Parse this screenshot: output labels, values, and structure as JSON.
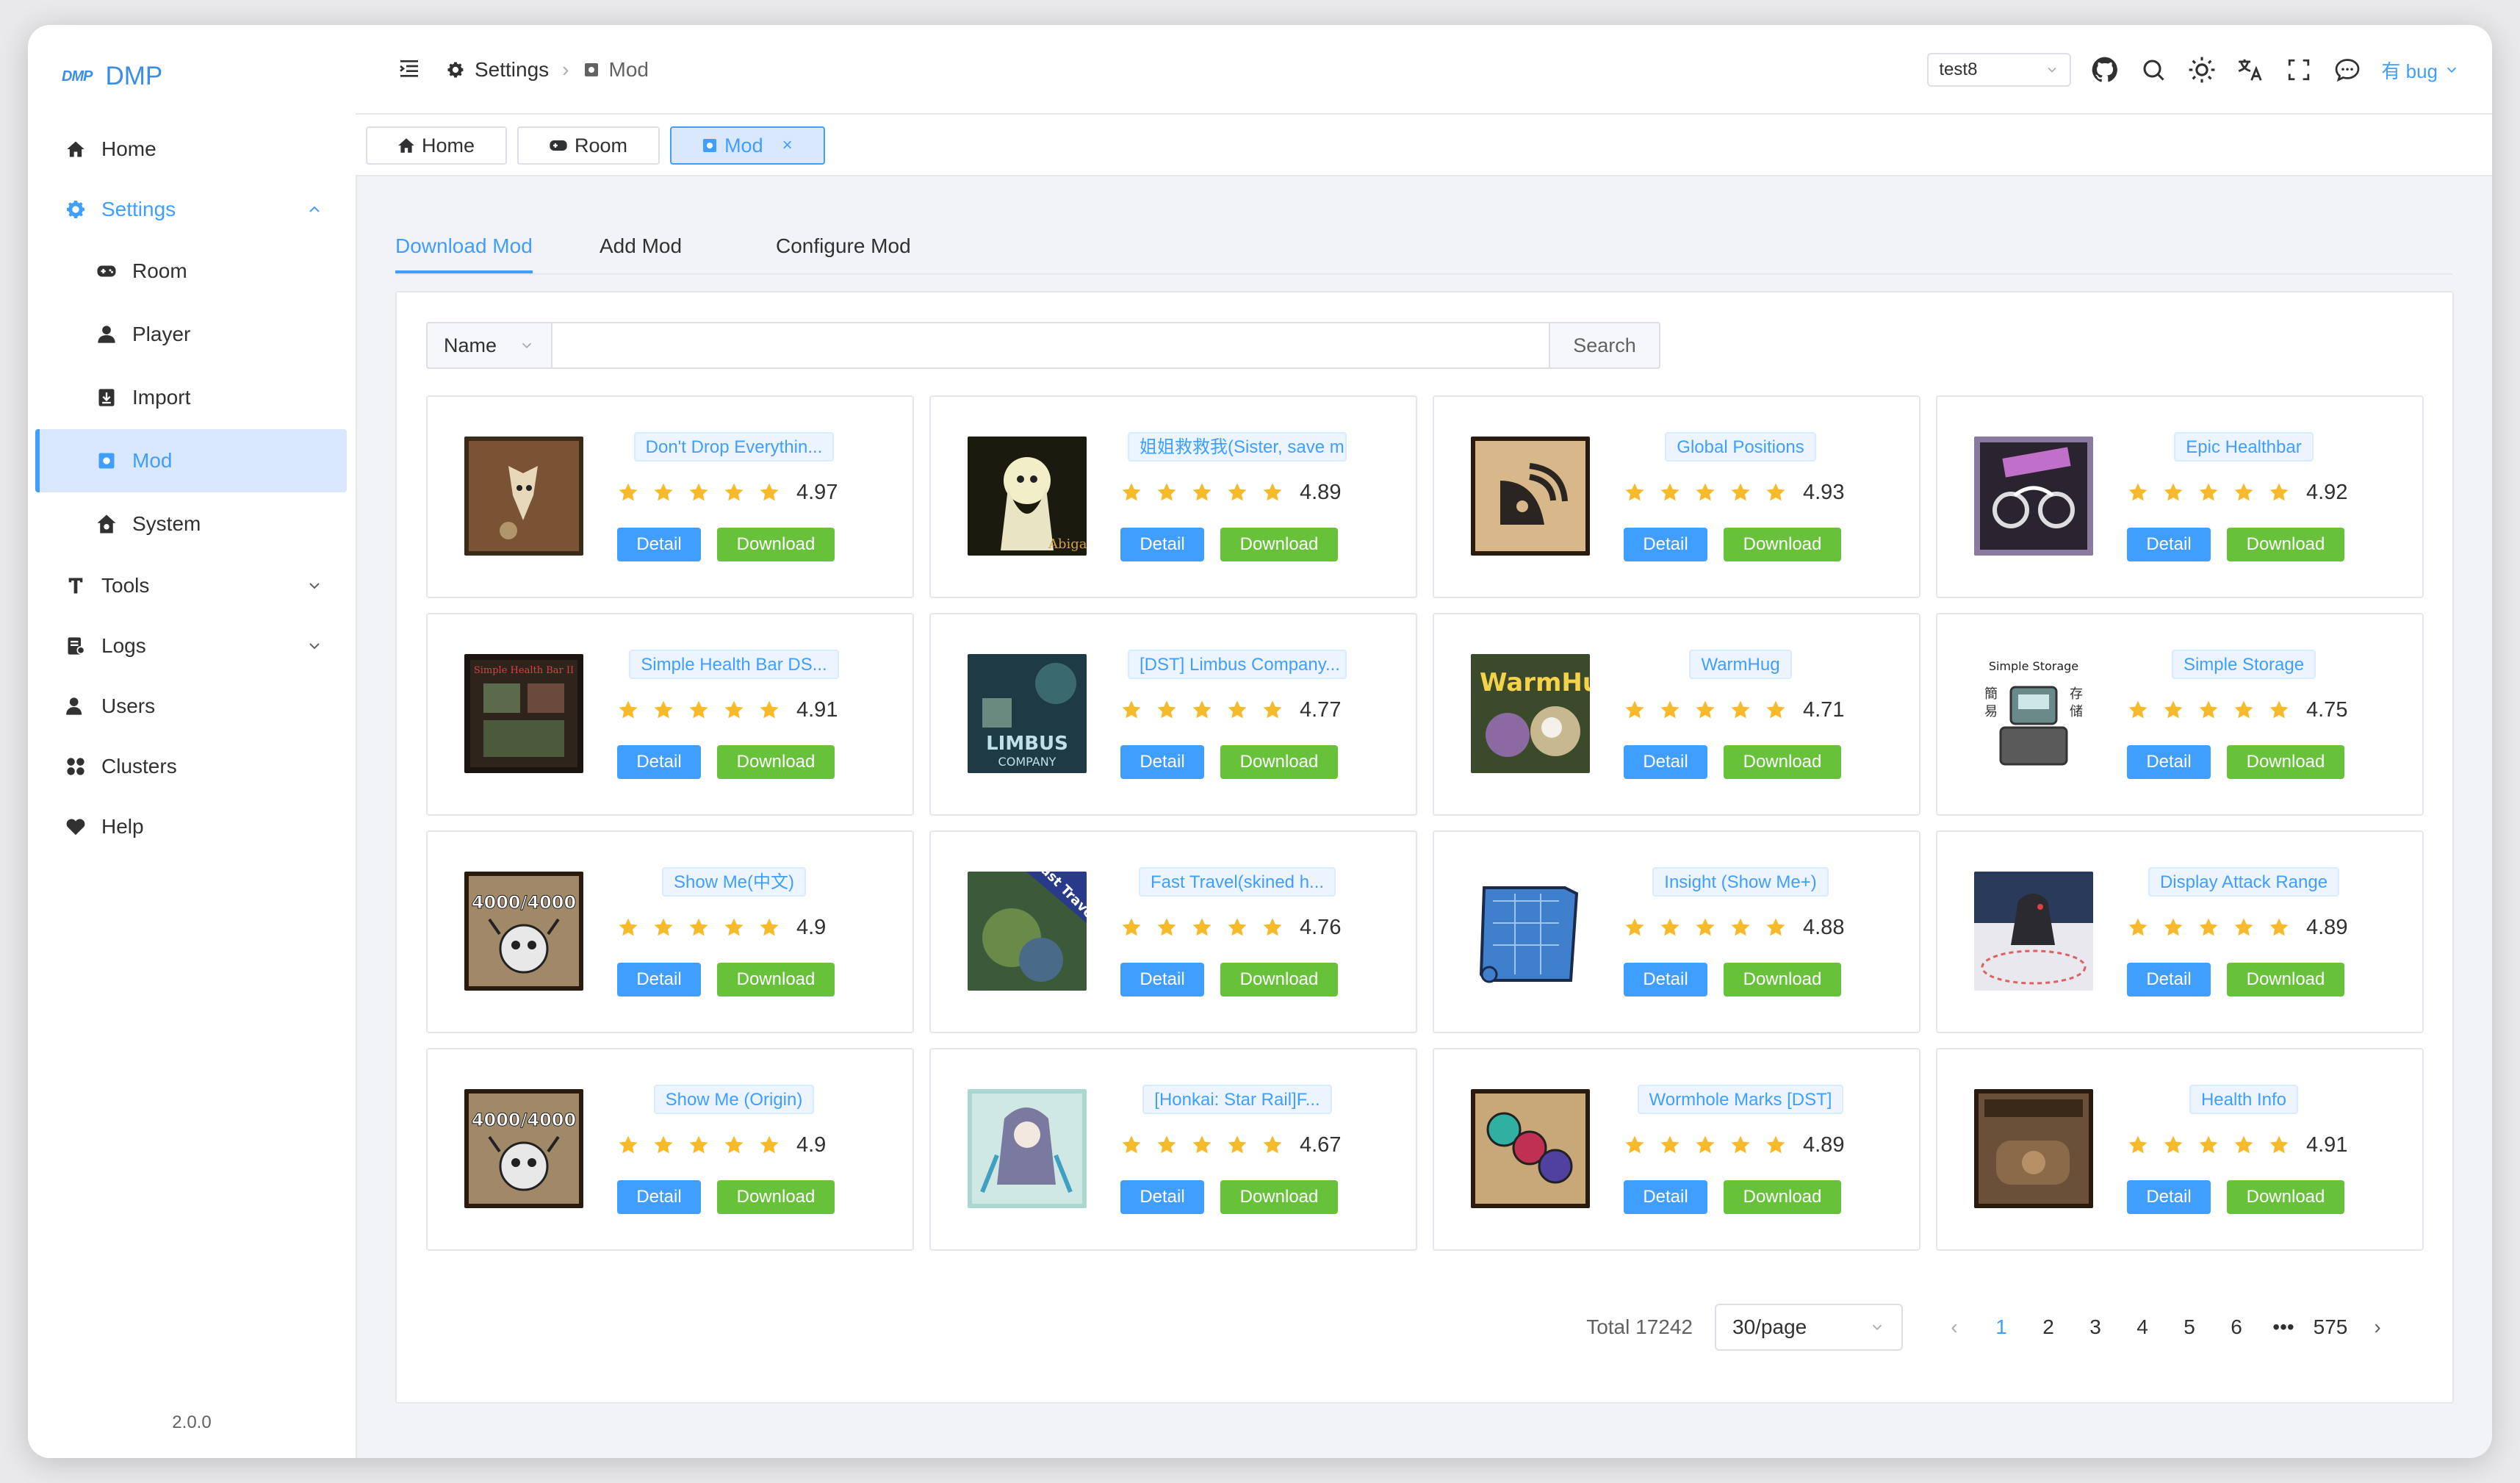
{
  "app": {
    "logo_text": "DMP",
    "name": "DMP",
    "version": "2.0.0"
  },
  "sidebar": {
    "items": [
      {
        "label": "Home"
      },
      {
        "label": "Settings"
      },
      {
        "label": "Room"
      },
      {
        "label": "Player"
      },
      {
        "label": "Import"
      },
      {
        "label": "Mod"
      },
      {
        "label": "System"
      },
      {
        "label": "Tools"
      },
      {
        "label": "Logs"
      },
      {
        "label": "Users"
      },
      {
        "label": "Clusters"
      },
      {
        "label": "Help"
      }
    ]
  },
  "header": {
    "breadcrumb": [
      "Settings",
      "Mod"
    ],
    "cluster_select": "test8",
    "user": "有 bug"
  },
  "tags": [
    {
      "label": "Home"
    },
    {
      "label": "Room"
    },
    {
      "label": "Mod",
      "close": "×"
    }
  ],
  "tabs": [
    "Download Mod",
    "Add Mod",
    "Configure Mod"
  ],
  "search": {
    "field": "Name",
    "button": "Search",
    "value": ""
  },
  "buttons": {
    "detail": "Detail",
    "download": "Download"
  },
  "mods": [
    {
      "name": "Don't Drop Everythin...",
      "rating": "4.97"
    },
    {
      "name": "姐姐救救我(Sister, save m...",
      "rating": "4.89"
    },
    {
      "name": "Global Positions",
      "rating": "4.93"
    },
    {
      "name": "Epic Healthbar",
      "rating": "4.92"
    },
    {
      "name": "Simple Health Bar DS...",
      "rating": "4.91",
      "thumb_text": "Simple Health Bar II"
    },
    {
      "name": "[DST] Limbus Company...",
      "rating": "4.77",
      "thumb_text": "LIMBUS COMPANY"
    },
    {
      "name": "WarmHug",
      "rating": "4.71",
      "thumb_text": "WarmHug"
    },
    {
      "name": "Simple Storage",
      "rating": "4.75",
      "thumb_text": "Simple Storage"
    },
    {
      "name": "Show Me(中文)",
      "rating": "4.9",
      "thumb_text": "4000/4000"
    },
    {
      "name": "Fast Travel(skined h...",
      "rating": "4.76",
      "thumb_text": "Fast Travel"
    },
    {
      "name": "Insight (Show Me+)",
      "rating": "4.88"
    },
    {
      "name": "Display Attack Range",
      "rating": "4.89"
    },
    {
      "name": "Show Me (Origin)",
      "rating": "4.9",
      "thumb_text": "4000/4000"
    },
    {
      "name": "[Honkai: Star Rail]F...",
      "rating": "4.67"
    },
    {
      "name": "Wormhole Marks [DST]",
      "rating": "4.89"
    },
    {
      "name": "Health Info",
      "rating": "4.91"
    }
  ],
  "pagination": {
    "total": "Total 17242",
    "page_size": "30/page",
    "pages": [
      "1",
      "2",
      "3",
      "4",
      "5",
      "6",
      "•••",
      "575"
    ],
    "current": "1"
  },
  "colors": {
    "primary": "#409eff",
    "success": "#67c23a",
    "star": "#f7ba2a"
  }
}
